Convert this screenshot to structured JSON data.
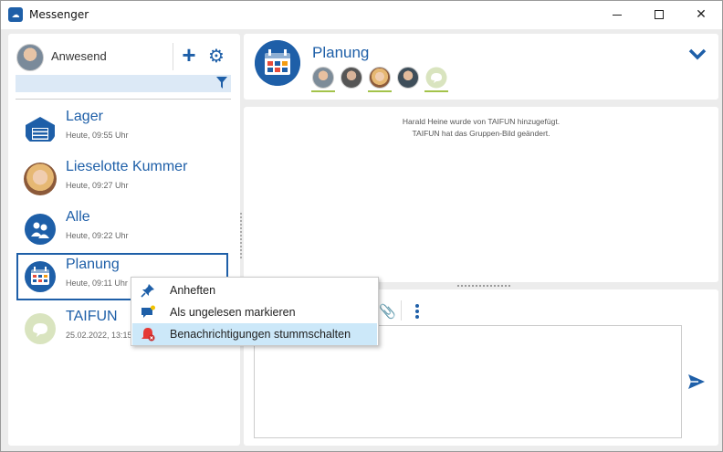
{
  "window": {
    "title": "Messenger",
    "minimize_glyph": "",
    "maximize_glyph": "",
    "close_glyph": "✕"
  },
  "sidebar": {
    "status": "Anwesend",
    "add_glyph": "+",
    "settings_glyph": "⚙",
    "conversations": [
      {
        "name": "Lager",
        "time": "Heute, 09:55 Uhr",
        "icon": "warehouse-icon"
      },
      {
        "name": "Lieselotte Kummer",
        "time": "Heute, 09:27 Uhr",
        "icon": "user-photo"
      },
      {
        "name": "Alle",
        "time": "Heute, 09:22 Uhr",
        "icon": "people-chat-icon"
      },
      {
        "name": "Planung",
        "time": "Heute, 09:11 Uhr",
        "icon": "calendar-icon",
        "selected": true
      },
      {
        "name": "TAIFUN",
        "time": "25.02.2022, 13:15 Uhr",
        "icon": "taifun-logo"
      }
    ]
  },
  "chat": {
    "title": "Planung",
    "members_count_shown": 5,
    "system_messages": [
      "Harald Heine wurde von TAIFUN hinzugefügt.",
      "TAIFUN hat das Gruppen-Bild geändert."
    ]
  },
  "context_menu": {
    "items": [
      {
        "label": "Anheften",
        "icon": "pin-icon"
      },
      {
        "label": "Als ungelesen markieren",
        "icon": "unread-chat-icon"
      },
      {
        "label": "Benachrichtigungen stummschalten",
        "icon": "mute-bell-icon"
      }
    ]
  },
  "colors": {
    "accent": "#1e5fa8",
    "member_underline": "#a3c34a",
    "menu_hover": "#cce8f9"
  }
}
